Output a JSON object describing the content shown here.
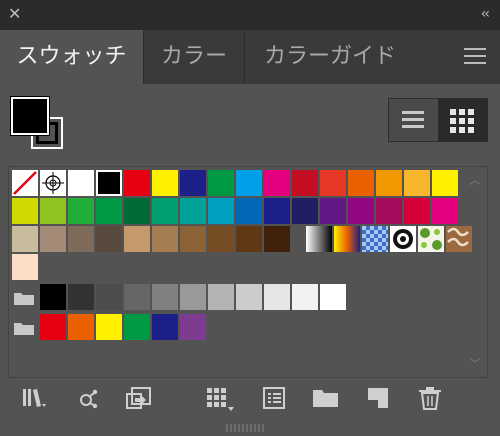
{
  "window": {
    "close_glyph": "✕",
    "collapse_glyph": "‹‹"
  },
  "tabs": [
    {
      "label": "スウォッチ",
      "active": true
    },
    {
      "label": "カラー",
      "active": false
    },
    {
      "label": "カラーガイド",
      "active": false
    }
  ],
  "fill_color": "#000000",
  "stroke_color": "#000000",
  "swatches": {
    "row1": [
      "#ffffff",
      "#000000",
      "#e60012",
      "#fff100",
      "#1d2088",
      "#009944",
      "#00a0e9",
      "#e4007f",
      "#c30d23",
      "#e83828",
      "#eb6100",
      "#f39800",
      "#f8b62d",
      "#fff100"
    ],
    "row2": [
      "#cfdb00",
      "#8fc31f",
      "#22ac38",
      "#009944",
      "#006934",
      "#00a073",
      "#00a29a",
      "#00a0c1",
      "#0068b7",
      "#1d2088",
      "#201f63",
      "#601986",
      "#920783",
      "#a40b5d",
      "#d7003a",
      "#e4007f"
    ],
    "row3": [
      "#c9bc9c",
      "#a48b78",
      "#7e6b5a",
      "#594a3e",
      "#c49a6c",
      "#a67c52",
      "#8c6239",
      "#754c24",
      "#603813",
      "#42210b"
    ],
    "row4": [
      "#fcdcc4"
    ],
    "group1": [
      "#000000",
      "#333333",
      "#4d4d4d",
      "#666666",
      "#808080",
      "#999999",
      "#b3b3b3",
      "#cccccc",
      "#e6e6e6",
      "#f2f2f2",
      "#ffffff"
    ],
    "group2": [
      "#e60012",
      "#eb6100",
      "#fff100",
      "#009944",
      "#1d2088",
      "#7d3b91"
    ]
  },
  "toolbar": [
    "swatch-libraries-icon",
    "show-kinds-icon",
    "place-swatch-icon",
    "swatch-options-icon",
    "new-color-group-icon",
    "new-folder-icon",
    "new-swatch-icon",
    "delete-swatch-icon"
  ]
}
